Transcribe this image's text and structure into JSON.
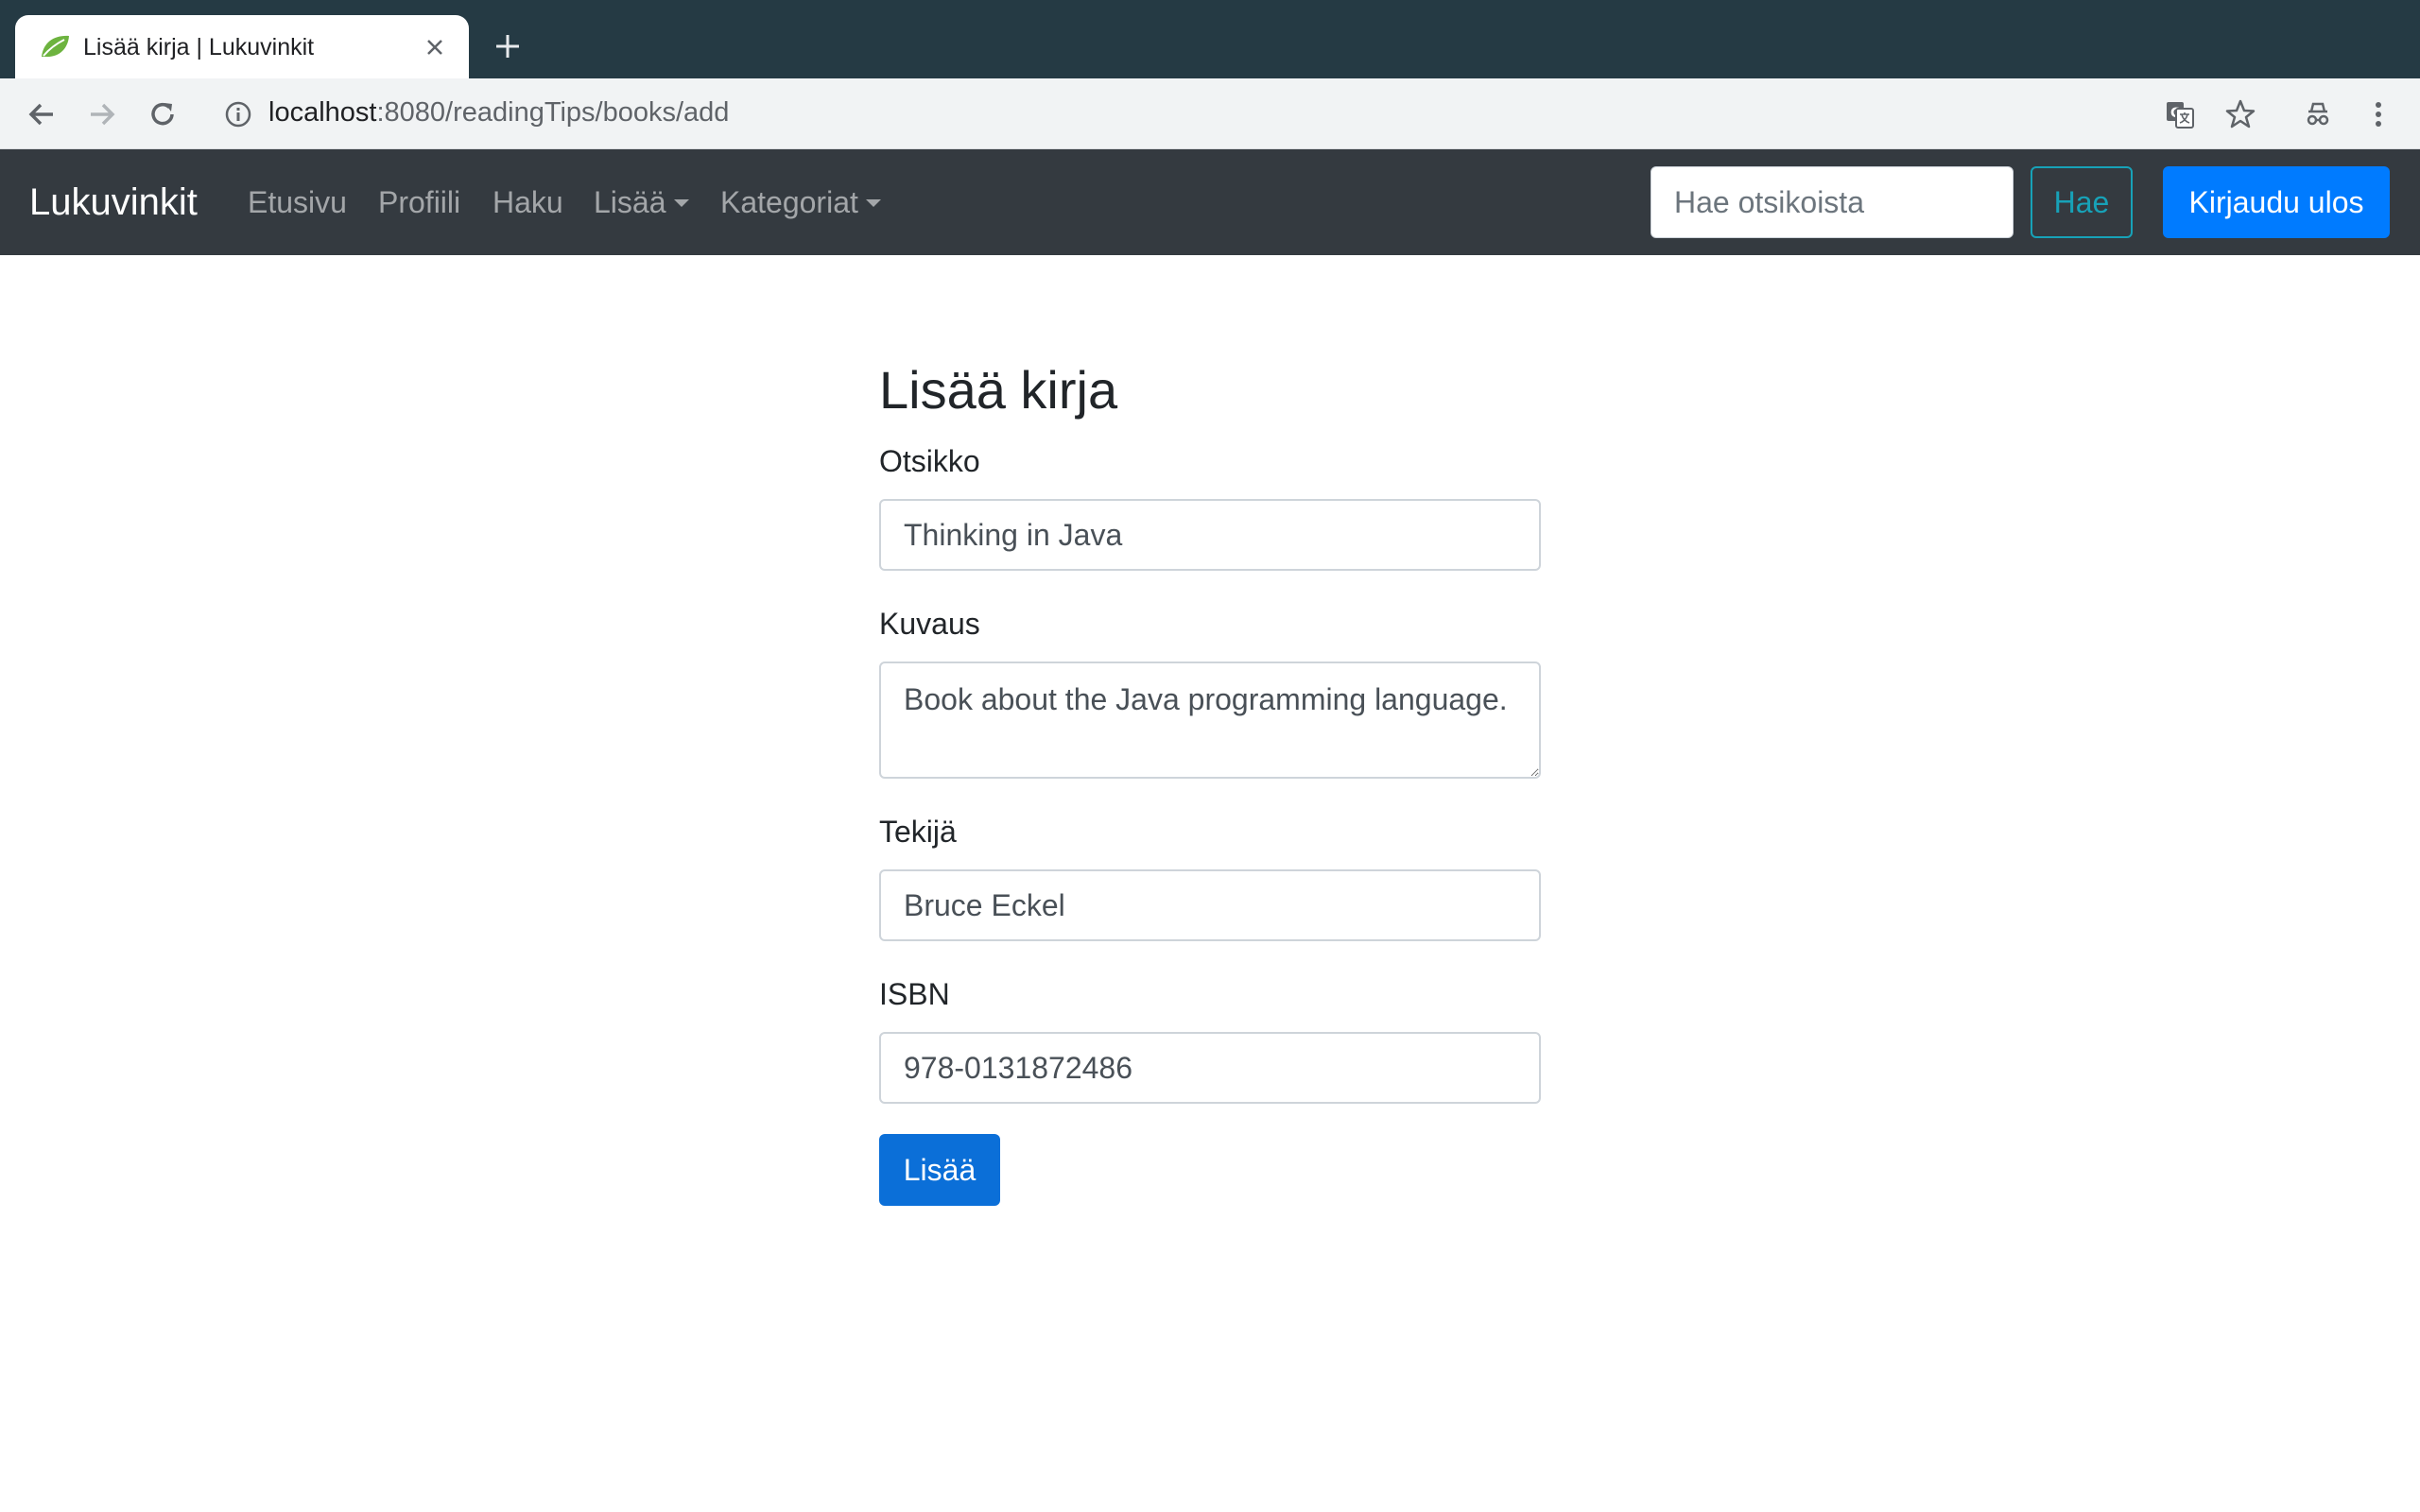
{
  "browser": {
    "tab_title": "Lisää kirja | Lukuvinkit",
    "url_host": "localhost",
    "url_path": ":8080/readingTips/books/add"
  },
  "navbar": {
    "brand": "Lukuvinkit",
    "links": [
      "Etusivu",
      "Profiili",
      "Haku",
      "Lisää",
      "Kategoriat"
    ],
    "search_placeholder": "Hae otsikoista",
    "search_button": "Hae",
    "logout_button": "Kirjaudu ulos"
  },
  "form": {
    "title": "Lisää kirja",
    "title_label": "Otsikko",
    "title_value": "Thinking in Java",
    "description_label": "Kuvaus",
    "description_value": "Book about the Java programming language.",
    "author_label": "Tekijä",
    "author_value": "Bruce Eckel",
    "isbn_label": "ISBN",
    "isbn_value": "978-0131872486",
    "submit_button": "Lisää"
  },
  "colors": {
    "navbar_bg": "#343a40",
    "primary": "#007bff",
    "info": "#17a2b8",
    "tabstrip_bg": "#253a44"
  }
}
